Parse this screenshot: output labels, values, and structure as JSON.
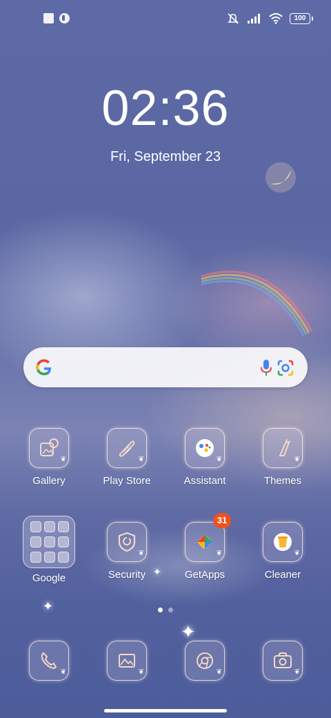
{
  "status_bar": {
    "left_icons": [
      "notification-square-icon",
      "notification-round-icon"
    ],
    "right_icons": [
      "mute-icon",
      "signal-icon",
      "wifi-icon"
    ],
    "battery_level": "100"
  },
  "lockclock": {
    "time": "02:36",
    "date": "Fri, September 23"
  },
  "search_bar": {
    "icons": [
      "google-logo-icon",
      "microphone-icon",
      "google-lens-icon"
    ]
  },
  "apps_row1": [
    {
      "label": "Gallery",
      "icon": "gallery-icon"
    },
    {
      "label": "Play Store",
      "icon": "play-store-icon"
    },
    {
      "label": "Assistant",
      "icon": "assistant-icon"
    },
    {
      "label": "Themes",
      "icon": "themes-icon"
    }
  ],
  "apps_row2": [
    {
      "label": "Google",
      "icon": "folder-icon"
    },
    {
      "label": "Security",
      "icon": "security-icon"
    },
    {
      "label": "GetApps",
      "icon": "getapps-icon",
      "badge": "31"
    },
    {
      "label": "Cleaner",
      "icon": "cleaner-icon"
    }
  ],
  "dock": [
    {
      "icon": "phone-icon"
    },
    {
      "icon": "photos-icon"
    },
    {
      "icon": "chrome-icon"
    },
    {
      "icon": "camera-icon"
    }
  ],
  "page_indicator": {
    "pages": 2,
    "active": 1
  },
  "colors": {
    "accent": "#f0511e",
    "wallpaper": "#5d6aa6"
  }
}
